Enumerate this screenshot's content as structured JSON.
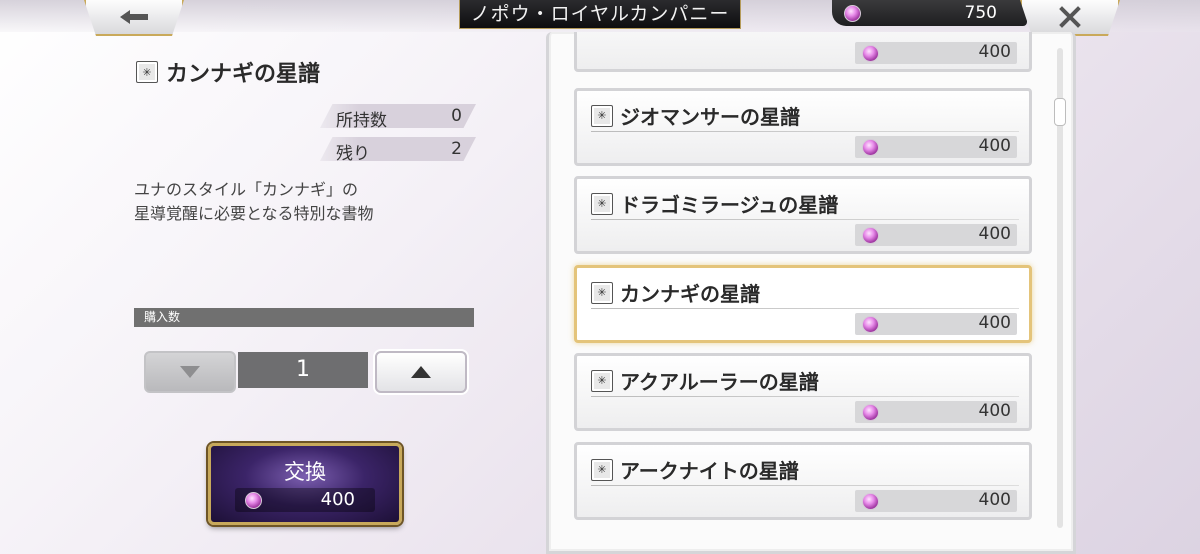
{
  "header": {
    "title": "ノポウ・ロイヤルカンパニー",
    "currency_amount": "750",
    "back_icon": "arrow-left-icon",
    "close_icon": "close-icon"
  },
  "detail": {
    "item_name": "カンナギの星譜",
    "owned_label": "所持数",
    "owned_value": "0",
    "remaining_label": "残り",
    "remaining_value": "2",
    "description": "ユナのスタイル「カンナギ」の\n星導覚醒に必要となる特別な書物"
  },
  "purchase": {
    "qty_label": "購入数",
    "quantity": "1",
    "exchange_label": "交換",
    "exchange_price": "400"
  },
  "list": {
    "items": [
      {
        "name": "",
        "price": "400"
      },
      {
        "name": "ジオマンサーの星譜",
        "price": "400"
      },
      {
        "name": "ドラゴミラージュの星譜",
        "price": "400"
      },
      {
        "name": "カンナギの星譜",
        "price": "400",
        "selected": true
      },
      {
        "name": "アクアルーラーの星譜",
        "price": "400"
      },
      {
        "name": "アークナイトの星譜",
        "price": "400"
      }
    ]
  },
  "colors": {
    "accent_gold": "#c8a95b",
    "gem": "#d05fd4",
    "exchange_button": "#3b2468"
  }
}
